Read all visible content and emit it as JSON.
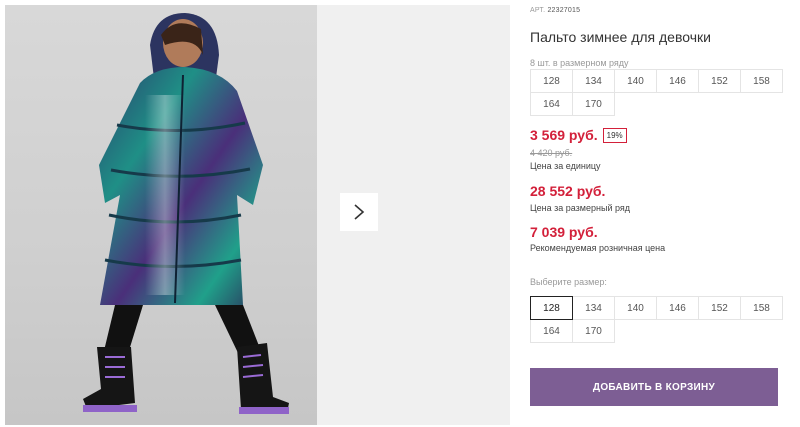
{
  "product": {
    "article_label": "АРТ.",
    "article_number": "22327015",
    "title": "Пальто зимнее для девочки"
  },
  "size_row": {
    "caption": "8 шт. в размерном ряду",
    "sizes": [
      "128",
      "134",
      "140",
      "146",
      "152",
      "158",
      "164",
      "170"
    ]
  },
  "prices": {
    "unit_price": "3 569 руб.",
    "discount": "19%",
    "old_price": "4 420 руб.",
    "unit_price_note": "Цена за единицу",
    "row_price": "28 552 руб.",
    "row_price_note": "Цена за размерный ряд",
    "retail_price": "7 039 руб.",
    "retail_price_note": "Рекомендуемая розничная цена"
  },
  "size_select": {
    "caption": "Выберите размер:",
    "sizes": [
      "128",
      "134",
      "140",
      "146",
      "152",
      "158",
      "164",
      "170"
    ],
    "selected": "128"
  },
  "cart": {
    "add_label": "ДОБАВИТЬ В КОРЗИНУ"
  },
  "colors": {
    "accent": "#7d5e94",
    "price": "#d3203a"
  },
  "icons": {
    "next": "chevron-right-icon"
  }
}
